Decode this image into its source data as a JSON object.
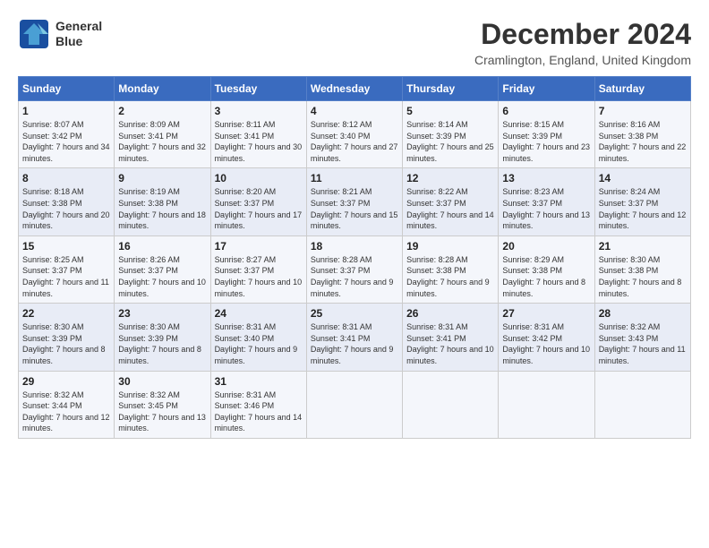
{
  "header": {
    "logo_line1": "General",
    "logo_line2": "Blue",
    "month_title": "December 2024",
    "location": "Cramlington, England, United Kingdom"
  },
  "days_of_week": [
    "Sunday",
    "Monday",
    "Tuesday",
    "Wednesday",
    "Thursday",
    "Friday",
    "Saturday"
  ],
  "weeks": [
    [
      {
        "day": "1",
        "sunrise": "Sunrise: 8:07 AM",
        "sunset": "Sunset: 3:42 PM",
        "daylight": "Daylight: 7 hours and 34 minutes."
      },
      {
        "day": "2",
        "sunrise": "Sunrise: 8:09 AM",
        "sunset": "Sunset: 3:41 PM",
        "daylight": "Daylight: 7 hours and 32 minutes."
      },
      {
        "day": "3",
        "sunrise": "Sunrise: 8:11 AM",
        "sunset": "Sunset: 3:41 PM",
        "daylight": "Daylight: 7 hours and 30 minutes."
      },
      {
        "day": "4",
        "sunrise": "Sunrise: 8:12 AM",
        "sunset": "Sunset: 3:40 PM",
        "daylight": "Daylight: 7 hours and 27 minutes."
      },
      {
        "day": "5",
        "sunrise": "Sunrise: 8:14 AM",
        "sunset": "Sunset: 3:39 PM",
        "daylight": "Daylight: 7 hours and 25 minutes."
      },
      {
        "day": "6",
        "sunrise": "Sunrise: 8:15 AM",
        "sunset": "Sunset: 3:39 PM",
        "daylight": "Daylight: 7 hours and 23 minutes."
      },
      {
        "day": "7",
        "sunrise": "Sunrise: 8:16 AM",
        "sunset": "Sunset: 3:38 PM",
        "daylight": "Daylight: 7 hours and 22 minutes."
      }
    ],
    [
      {
        "day": "8",
        "sunrise": "Sunrise: 8:18 AM",
        "sunset": "Sunset: 3:38 PM",
        "daylight": "Daylight: 7 hours and 20 minutes."
      },
      {
        "day": "9",
        "sunrise": "Sunrise: 8:19 AM",
        "sunset": "Sunset: 3:38 PM",
        "daylight": "Daylight: 7 hours and 18 minutes."
      },
      {
        "day": "10",
        "sunrise": "Sunrise: 8:20 AM",
        "sunset": "Sunset: 3:37 PM",
        "daylight": "Daylight: 7 hours and 17 minutes."
      },
      {
        "day": "11",
        "sunrise": "Sunrise: 8:21 AM",
        "sunset": "Sunset: 3:37 PM",
        "daylight": "Daylight: 7 hours and 15 minutes."
      },
      {
        "day": "12",
        "sunrise": "Sunrise: 8:22 AM",
        "sunset": "Sunset: 3:37 PM",
        "daylight": "Daylight: 7 hours and 14 minutes."
      },
      {
        "day": "13",
        "sunrise": "Sunrise: 8:23 AM",
        "sunset": "Sunset: 3:37 PM",
        "daylight": "Daylight: 7 hours and 13 minutes."
      },
      {
        "day": "14",
        "sunrise": "Sunrise: 8:24 AM",
        "sunset": "Sunset: 3:37 PM",
        "daylight": "Daylight: 7 hours and 12 minutes."
      }
    ],
    [
      {
        "day": "15",
        "sunrise": "Sunrise: 8:25 AM",
        "sunset": "Sunset: 3:37 PM",
        "daylight": "Daylight: 7 hours and 11 minutes."
      },
      {
        "day": "16",
        "sunrise": "Sunrise: 8:26 AM",
        "sunset": "Sunset: 3:37 PM",
        "daylight": "Daylight: 7 hours and 10 minutes."
      },
      {
        "day": "17",
        "sunrise": "Sunrise: 8:27 AM",
        "sunset": "Sunset: 3:37 PM",
        "daylight": "Daylight: 7 hours and 10 minutes."
      },
      {
        "day": "18",
        "sunrise": "Sunrise: 8:28 AM",
        "sunset": "Sunset: 3:37 PM",
        "daylight": "Daylight: 7 hours and 9 minutes."
      },
      {
        "day": "19",
        "sunrise": "Sunrise: 8:28 AM",
        "sunset": "Sunset: 3:38 PM",
        "daylight": "Daylight: 7 hours and 9 minutes."
      },
      {
        "day": "20",
        "sunrise": "Sunrise: 8:29 AM",
        "sunset": "Sunset: 3:38 PM",
        "daylight": "Daylight: 7 hours and 8 minutes."
      },
      {
        "day": "21",
        "sunrise": "Sunrise: 8:30 AM",
        "sunset": "Sunset: 3:38 PM",
        "daylight": "Daylight: 7 hours and 8 minutes."
      }
    ],
    [
      {
        "day": "22",
        "sunrise": "Sunrise: 8:30 AM",
        "sunset": "Sunset: 3:39 PM",
        "daylight": "Daylight: 7 hours and 8 minutes."
      },
      {
        "day": "23",
        "sunrise": "Sunrise: 8:30 AM",
        "sunset": "Sunset: 3:39 PM",
        "daylight": "Daylight: 7 hours and 8 minutes."
      },
      {
        "day": "24",
        "sunrise": "Sunrise: 8:31 AM",
        "sunset": "Sunset: 3:40 PM",
        "daylight": "Daylight: 7 hours and 9 minutes."
      },
      {
        "day": "25",
        "sunrise": "Sunrise: 8:31 AM",
        "sunset": "Sunset: 3:41 PM",
        "daylight": "Daylight: 7 hours and 9 minutes."
      },
      {
        "day": "26",
        "sunrise": "Sunrise: 8:31 AM",
        "sunset": "Sunset: 3:41 PM",
        "daylight": "Daylight: 7 hours and 10 minutes."
      },
      {
        "day": "27",
        "sunrise": "Sunrise: 8:31 AM",
        "sunset": "Sunset: 3:42 PM",
        "daylight": "Daylight: 7 hours and 10 minutes."
      },
      {
        "day": "28",
        "sunrise": "Sunrise: 8:32 AM",
        "sunset": "Sunset: 3:43 PM",
        "daylight": "Daylight: 7 hours and 11 minutes."
      }
    ],
    [
      {
        "day": "29",
        "sunrise": "Sunrise: 8:32 AM",
        "sunset": "Sunset: 3:44 PM",
        "daylight": "Daylight: 7 hours and 12 minutes."
      },
      {
        "day": "30",
        "sunrise": "Sunrise: 8:32 AM",
        "sunset": "Sunset: 3:45 PM",
        "daylight": "Daylight: 7 hours and 13 minutes."
      },
      {
        "day": "31",
        "sunrise": "Sunrise: 8:31 AM",
        "sunset": "Sunset: 3:46 PM",
        "daylight": "Daylight: 7 hours and 14 minutes."
      },
      null,
      null,
      null,
      null
    ]
  ]
}
